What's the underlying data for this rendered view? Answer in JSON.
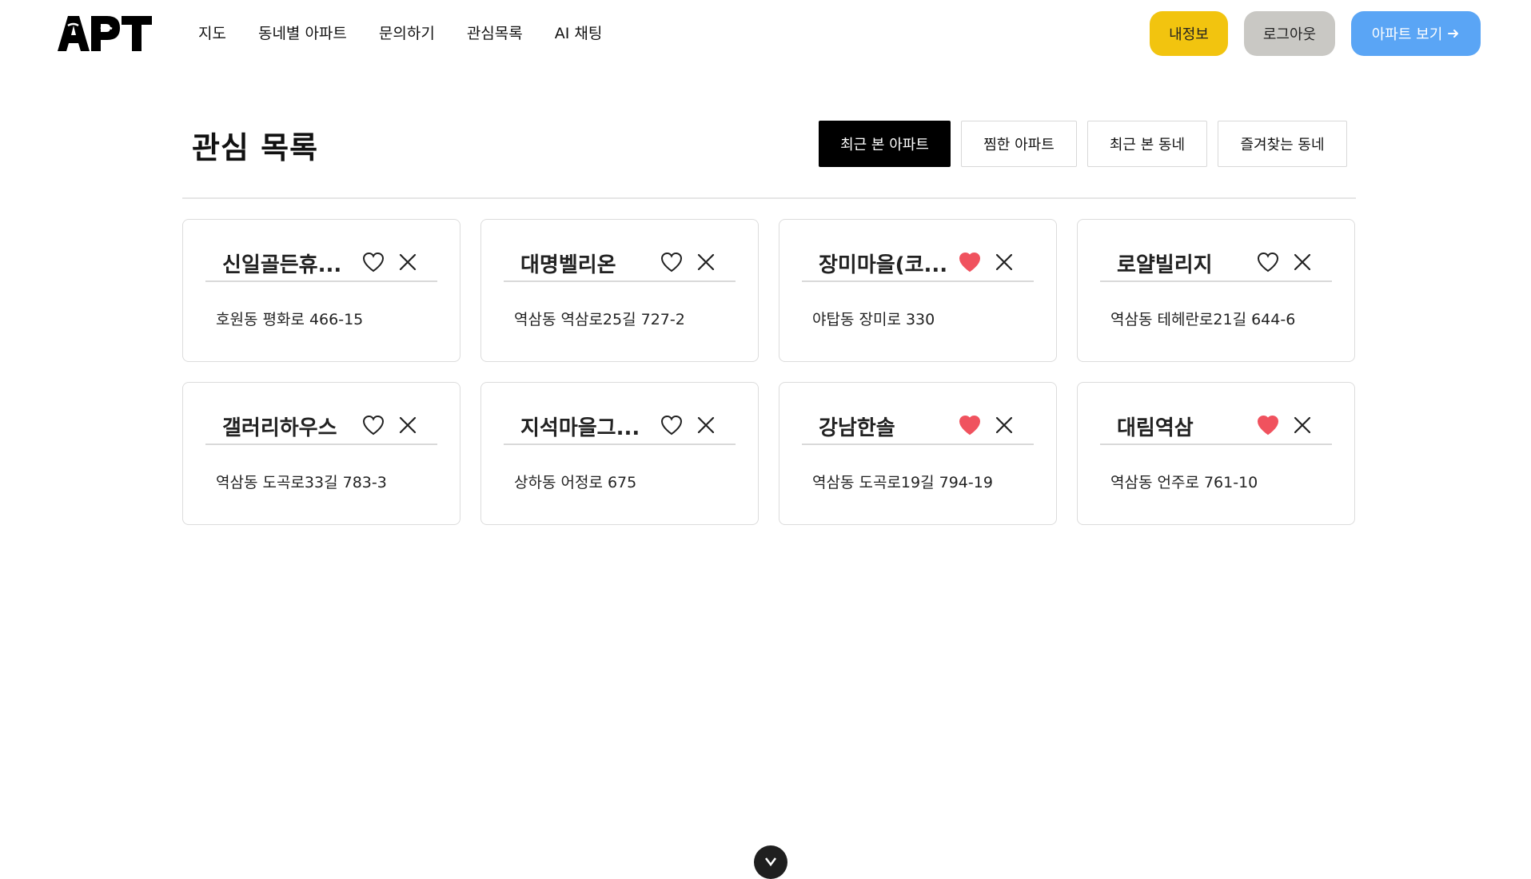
{
  "header": {
    "logo": "APT",
    "nav": [
      "지도",
      "동네별 아파트",
      "문의하기",
      "관심목록",
      "AI 채팅"
    ],
    "myinfo_label": "내정보",
    "logout_label": "로그아웃",
    "view_apt_label": "아파트 보기",
    "colors": {
      "myinfo": "#f2c40f",
      "logout": "#c9c8c4",
      "view_apt": "#5aa5f5"
    }
  },
  "main": {
    "title": "관심 목록",
    "tabs": [
      {
        "label": "최근 본 아파트",
        "active": true
      },
      {
        "label": "찜한 아파트",
        "active": false
      },
      {
        "label": "최근 본 동네",
        "active": false
      },
      {
        "label": "즐겨찾는 동네",
        "active": false
      }
    ],
    "cards": [
      {
        "name": "신일골든휴...",
        "address": "호원동 평화로 466-15",
        "liked": false
      },
      {
        "name": "대명벨리온",
        "address": "역삼동 역삼로25길 727-2",
        "liked": false
      },
      {
        "name": "장미마을(코...",
        "address": "야탑동 장미로 330",
        "liked": true
      },
      {
        "name": "로얄빌리지",
        "address": "역삼동 테헤란로21길 644-6",
        "liked": false
      },
      {
        "name": "갤러리하우스",
        "address": "역삼동 도곡로33길 783-3",
        "liked": false
      },
      {
        "name": "지석마을그...",
        "address": "상하동 어정로 675",
        "liked": false
      },
      {
        "name": "강남한솔",
        "address": "역삼동 도곡로19길 794-19",
        "liked": true
      },
      {
        "name": "대림역삼",
        "address": "역삼동 언주로 761-10",
        "liked": true
      }
    ],
    "heart_color": "#f0525e"
  }
}
